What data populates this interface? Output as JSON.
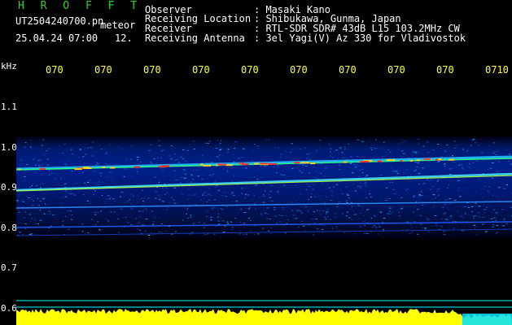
{
  "header": {
    "program": "H R O F F T",
    "filename": "UT2504240700.pn",
    "meteor_label": "meteor",
    "datetime": "25.04.24 07:00",
    "count": "12.",
    "observer_label": "Observer",
    "observer_value": ": Masaki Kano",
    "location_label": "Receiving Location",
    "location_value": ": Shibukawa, Gunma, Japan",
    "receiver_label": "Receiver",
    "receiver_value": ": RTL-SDR SDR# 43dB L15 103.2MHz CW",
    "antenna_label": "Receiving Antenna",
    "antenna_value": ": 3el Yagi(V) Az 330 for Vladivostok"
  },
  "colors": {
    "program": "#2ad62a",
    "time_ticks": "#ffff33",
    "power_trace": "#ffff00",
    "cursor_lines": "#00ffff"
  },
  "chart_data": {
    "type": "heatmap",
    "ylabel": "kHz",
    "y_ticks": [
      "1.1",
      "1.0",
      "0.9",
      "0.8",
      "0.7",
      "0.6"
    ],
    "x_ticks": [
      "070",
      "070",
      "070",
      "070",
      "070",
      "070",
      "070",
      "070",
      "070",
      "0710"
    ],
    "ylim": [
      0.6,
      1.1
    ]
  }
}
